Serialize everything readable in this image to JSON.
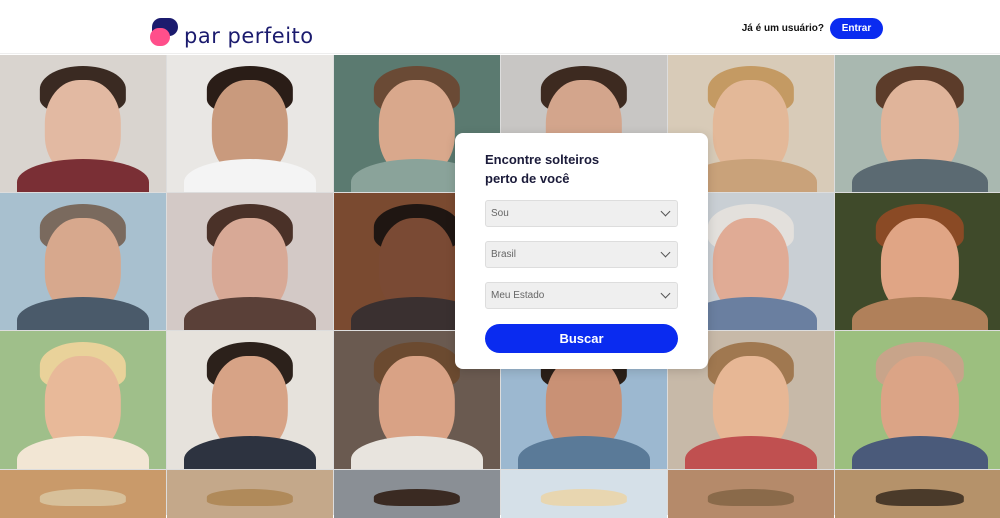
{
  "header": {
    "logo_text": "par perfeito",
    "login_question": "Já é um usuário?",
    "login_button": "Entrar"
  },
  "search": {
    "title_line1": "Encontre solteiros",
    "title_line2": "perto de você",
    "gender_select": "Sou",
    "country_select": "Brasil",
    "state_select": "Meu Estado",
    "search_button": "Buscar"
  },
  "colors": {
    "brand_navy": "#1b1b6e",
    "brand_pink": "#ff4f8b",
    "accent_blue": "#0a2bf0"
  }
}
